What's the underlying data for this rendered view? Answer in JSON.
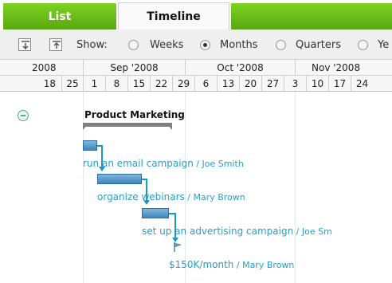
{
  "tabs": {
    "list": "List",
    "timeline": "Timeline"
  },
  "toolbar": {
    "show_label": "Show:",
    "scale_options": [
      {
        "label": "Weeks",
        "checked": false
      },
      {
        "label": "Months",
        "checked": true
      },
      {
        "label": "Quarters",
        "checked": false
      },
      {
        "label": "Ye",
        "checked": false
      }
    ]
  },
  "timeline_header": {
    "months": [
      "2008",
      "Sep '2008",
      "Oct '2008",
      "Nov '2008"
    ],
    "days": [
      "18",
      "25",
      "1",
      "8",
      "15",
      "22",
      "29",
      "6",
      "13",
      "20",
      "27",
      "3",
      "10",
      "17",
      "24"
    ]
  },
  "group": {
    "title": "Product Marketing"
  },
  "tasks": [
    {
      "name": "run an email campaign",
      "owner": " / Joe Smith"
    },
    {
      "name": "organize webinars",
      "owner": " / Mary Brown"
    },
    {
      "name": "set up an advertising campaign",
      "owner": " / Joe Sm"
    },
    {
      "name": "$150K/month",
      "owner": " / Mary Brown"
    }
  ],
  "colors": {
    "tab_green": "#6cbf1a",
    "task_bar": "#4a90c8",
    "task_text": "#2a9ec9",
    "connector": "#129cc4",
    "group_bar": "#808080"
  }
}
